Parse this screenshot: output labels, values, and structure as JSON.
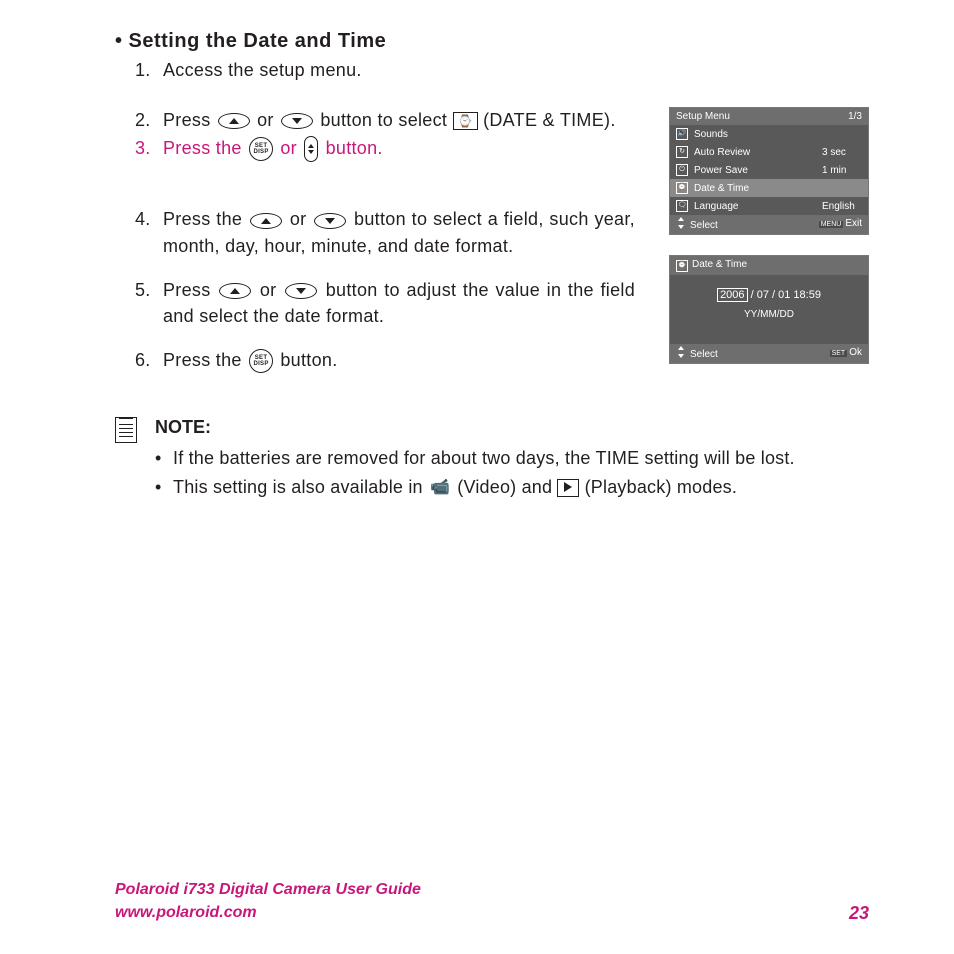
{
  "heading": "Setting the Date and Time",
  "steps": {
    "s1_num": "1.",
    "s1": "Access the setup menu.",
    "s2_num": "2.",
    "s2a": "Press ",
    "s2b": " or ",
    "s2c": " button to select ",
    "s2d": " (DATE & TIME).",
    "s3_num": "3.",
    "s3a": "Press the ",
    "s3b": " or ",
    "s3c": " button.",
    "s4_num": "4.",
    "s4a": "Press the  ",
    "s4b": " or ",
    "s4c": " button to select a field, such year, month, day, hour, minute, and date format.",
    "s5_num": "5.",
    "s5a": "Press ",
    "s5b": " or ",
    "s5c": " button to adjust the value in the field and select the date format.",
    "s6_num": "6.",
    "s6a": "Press  the ",
    "s6b": " button."
  },
  "set_disp": {
    "line1": "SET",
    "line2": "DISP"
  },
  "note": {
    "title": "NOTE:",
    "n1": "If the batteries are removed for about two days, the TIME setting will be lost.",
    "n2a": "This setting is also available in ",
    "n2b": " (Video) and ",
    "n2c": " (Playback) modes."
  },
  "lcd1": {
    "title": "Setup Menu",
    "page": "1/3",
    "rows": [
      {
        "label": "Sounds",
        "val": ""
      },
      {
        "label": "Auto Review",
        "val": "3 sec"
      },
      {
        "label": "Power Save",
        "val": "1 min"
      },
      {
        "label": "Date & Time",
        "val": ""
      },
      {
        "label": "Language",
        "val": "English"
      }
    ],
    "select": "Select",
    "menu": "MENU",
    "exit": "Exit"
  },
  "lcd2": {
    "title": "Date & Time",
    "year": "2006",
    "rest": " / 07 / 01   18:59",
    "fmt": "YY/MM/DD",
    "select": "Select",
    "set": "SET",
    "ok": "Ok"
  },
  "footer": {
    "line1": "Polaroid i733 Digital Camera User Guide",
    "line2": "www.polaroid.com",
    "page": "23"
  }
}
